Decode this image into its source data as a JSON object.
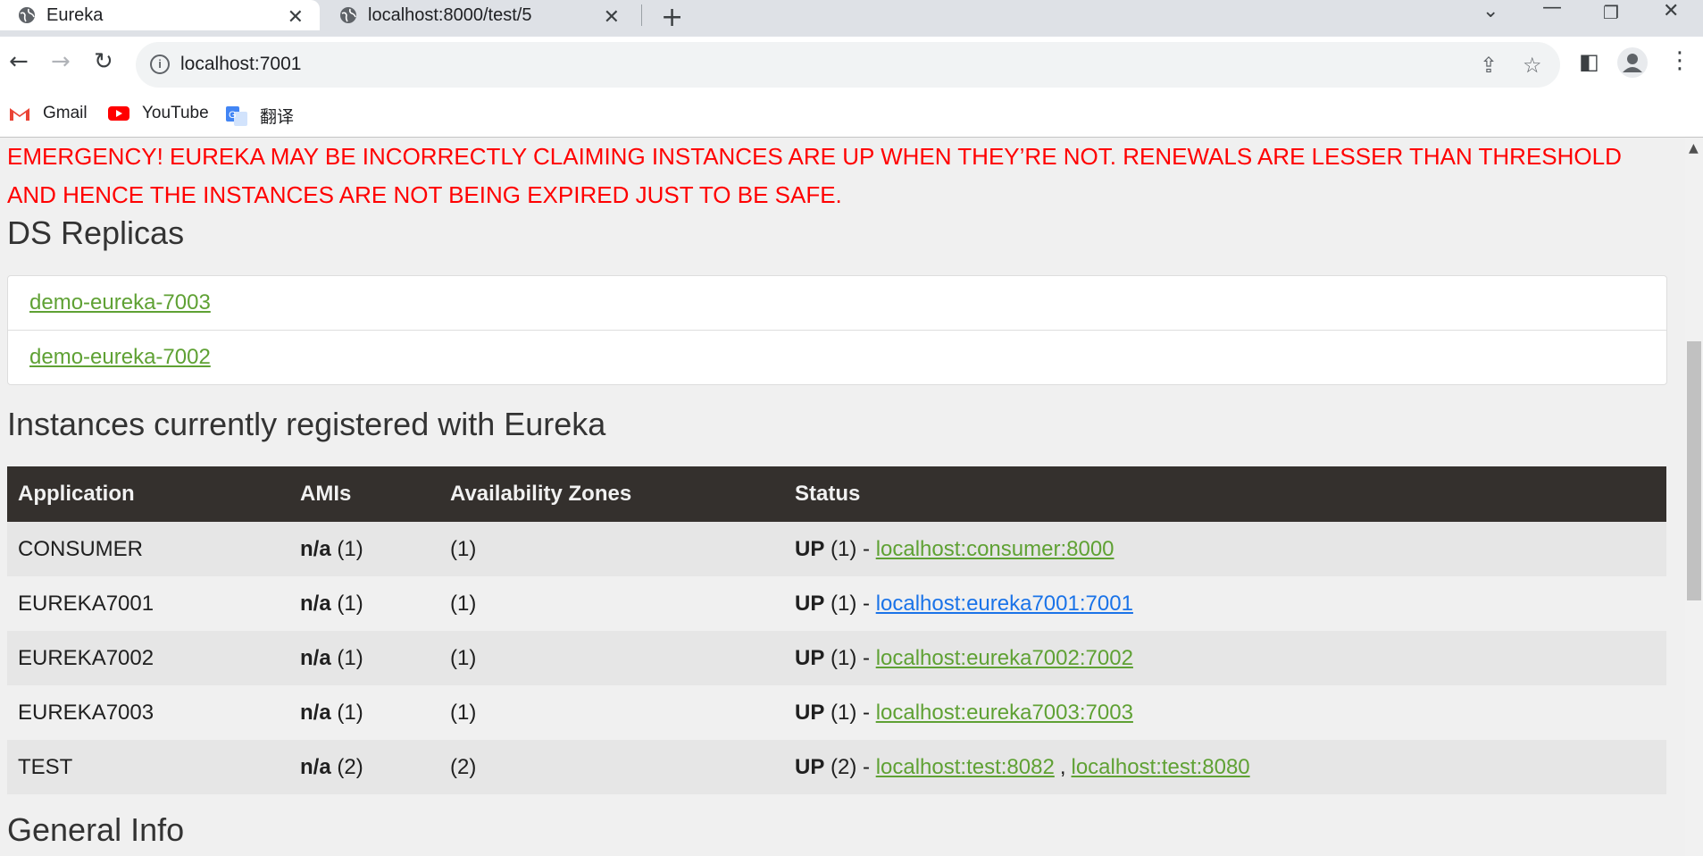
{
  "browser": {
    "tabs": [
      {
        "title": "Eureka",
        "active": true
      },
      {
        "title": "localhost:8000/test/5",
        "active": false
      }
    ],
    "address": "localhost:7001",
    "bookmarks": [
      {
        "label": "Gmail",
        "icon": "gmail-icon"
      },
      {
        "label": "YouTube",
        "icon": "youtube-icon"
      },
      {
        "label": "翻译",
        "icon": "translate-icon"
      }
    ]
  },
  "page": {
    "emergency": "EMERGENCY! EUREKA MAY BE INCORRECTLY CLAIMING INSTANCES ARE UP WHEN THEY’RE NOT. RENEWALS ARE LESSER THAN THRESHOLD AND HENCE THE INSTANCES ARE NOT BEING EXPIRED JUST TO BE SAFE.",
    "replicas_title": "DS Replicas",
    "replicas": [
      "demo-eureka-7003",
      "demo-eureka-7002"
    ],
    "instances_title": "Instances currently registered with Eureka",
    "table": {
      "headers": [
        "Application",
        "AMIs",
        "Availability Zones",
        "Status"
      ],
      "rows": [
        {
          "app": "CONSUMER",
          "ami": "n/a",
          "ami_count": "(1)",
          "zones": "(1)",
          "status": "UP",
          "status_count": "(1) -",
          "links": [
            "localhost:consumer:8000"
          ]
        },
        {
          "app": "EUREKA7001",
          "ami": "n/a",
          "ami_count": "(1)",
          "zones": "(1)",
          "status": "UP",
          "status_count": "(1) -",
          "links": [
            "localhost:eureka7001:7001"
          ]
        },
        {
          "app": "EUREKA7002",
          "ami": "n/a",
          "ami_count": "(1)",
          "zones": "(1)",
          "status": "UP",
          "status_count": "(1) -",
          "links": [
            "localhost:eureka7002:7002"
          ]
        },
        {
          "app": "EUREKA7003",
          "ami": "n/a",
          "ami_count": "(1)",
          "zones": "(1)",
          "status": "UP",
          "status_count": "(1) -",
          "links": [
            "localhost:eureka7003:7003"
          ]
        },
        {
          "app": "TEST",
          "ami": "n/a",
          "ami_count": "(2)",
          "zones": "(2)",
          "status": "UP",
          "status_count": "(2) -",
          "links": [
            "localhost:test:8082",
            "localhost:test:8080"
          ],
          "link_separator": ","
        }
      ]
    },
    "general_info_title": "General Info"
  },
  "colors": {
    "emergency": "#ff0000",
    "link": "#5fa134",
    "visited_link": "#1a73e8",
    "table_header_bg": "#34302d"
  }
}
